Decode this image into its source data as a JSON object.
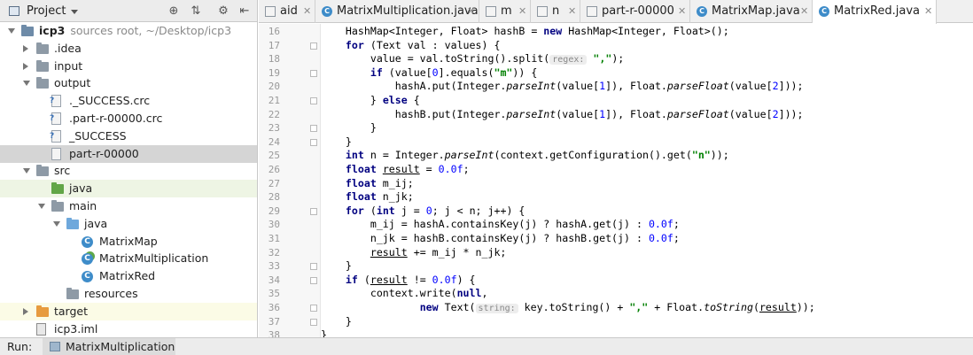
{
  "project_panel": {
    "title": "Project",
    "tree": [
      {
        "label": "icp3",
        "hint": "sources root,  ~/Desktop/icp3",
        "bold": true,
        "depth": 0,
        "arrow": "down",
        "icon": "module-folder"
      },
      {
        "label": ".idea",
        "depth": 1,
        "arrow": "right",
        "icon": "folder"
      },
      {
        "label": "input",
        "depth": 1,
        "arrow": "right",
        "icon": "folder"
      },
      {
        "label": "output",
        "depth": 1,
        "arrow": "down",
        "icon": "folder"
      },
      {
        "label": "._SUCCESS.crc",
        "depth": 2,
        "icon": "unknown-file"
      },
      {
        "label": ".part-r-00000.crc",
        "depth": 2,
        "icon": "unknown-file"
      },
      {
        "label": "_SUCCESS",
        "depth": 2,
        "icon": "unknown-file"
      },
      {
        "label": "part-r-00000",
        "depth": 2,
        "icon": "text-file",
        "selected": true
      },
      {
        "label": "src",
        "depth": 1,
        "arrow": "down",
        "icon": "folder"
      },
      {
        "label": "java",
        "depth": 2,
        "icon": "green-folder",
        "highlight": "green"
      },
      {
        "label": "main",
        "depth": 2,
        "arrow": "down",
        "icon": "folder"
      },
      {
        "label": "java",
        "depth": 3,
        "arrow": "down",
        "icon": "blue-folder"
      },
      {
        "label": "MatrixMap",
        "depth": 4,
        "icon": "class"
      },
      {
        "label": "MatrixMultiplication",
        "depth": 4,
        "icon": "class-run"
      },
      {
        "label": "MatrixRed",
        "depth": 4,
        "icon": "class"
      },
      {
        "label": "resources",
        "depth": 3,
        "icon": "resources-folder"
      },
      {
        "label": "target",
        "depth": 1,
        "arrow": "right",
        "icon": "orange-folder",
        "highlight": "yellow"
      },
      {
        "label": "icp3.iml",
        "depth": 1,
        "icon": "iml-file"
      }
    ]
  },
  "editor": {
    "tabs": [
      {
        "label": "aid",
        "icon": "file",
        "width": 64
      },
      {
        "label": "MatrixMultiplication.java",
        "icon": "class",
        "width": 185
      },
      {
        "label": "m",
        "icon": "file",
        "width": 58
      },
      {
        "label": "n",
        "icon": "file",
        "width": 56
      },
      {
        "label": "part-r-00000",
        "icon": "file",
        "width": 124
      },
      {
        "label": "MatrixMap.java",
        "icon": "class",
        "width": 138
      },
      {
        "label": "MatrixRed.java",
        "icon": "class",
        "width": 140,
        "active": true
      }
    ],
    "first_line": 16,
    "lines": [
      [
        [
          "    HashMap<Integer, Float> hashB = ",
          ""
        ],
        [
          "new",
          "k"
        ],
        [
          " HashMap<Integer, Float>();",
          ""
        ]
      ],
      [
        [
          "    ",
          ""
        ],
        [
          "for",
          "k"
        ],
        [
          " (Text val : values) {",
          ""
        ]
      ],
      [
        [
          "        value = val.toString().split(",
          ""
        ],
        [
          "regex:",
          "hint"
        ],
        [
          " ",
          ""
        ],
        [
          "\",\"",
          "s"
        ],
        [
          ");",
          ""
        ]
      ],
      [
        [
          "        ",
          ""
        ],
        [
          "if",
          "k"
        ],
        [
          " (value[",
          ""
        ],
        [
          "0",
          "n"
        ],
        [
          "].equals(",
          ""
        ],
        [
          "\"m\"",
          "s"
        ],
        [
          ")) {",
          ""
        ]
      ],
      [
        [
          "            hashA.put(Integer.",
          ""
        ],
        [
          "parseInt",
          "i"
        ],
        [
          "(value[",
          ""
        ],
        [
          "1",
          "n"
        ],
        [
          "]), Float.",
          ""
        ],
        [
          "parseFloat",
          "i"
        ],
        [
          "(value[",
          ""
        ],
        [
          "2",
          "n"
        ],
        [
          "]));",
          ""
        ]
      ],
      [
        [
          "        } ",
          ""
        ],
        [
          "else",
          "k"
        ],
        [
          " {",
          ""
        ]
      ],
      [
        [
          "            hashB.put(Integer.",
          ""
        ],
        [
          "parseInt",
          "i"
        ],
        [
          "(value[",
          ""
        ],
        [
          "1",
          "n"
        ],
        [
          "]), Float.",
          ""
        ],
        [
          "parseFloat",
          "i"
        ],
        [
          "(value[",
          ""
        ],
        [
          "2",
          "n"
        ],
        [
          "]));",
          ""
        ]
      ],
      [
        [
          "        }",
          ""
        ]
      ],
      [
        [
          "    }",
          ""
        ]
      ],
      [
        [
          "    ",
          ""
        ],
        [
          "int",
          "k"
        ],
        [
          " n = Integer.",
          ""
        ],
        [
          "parseInt",
          "i"
        ],
        [
          "(context.getConfiguration().get(",
          ""
        ],
        [
          "\"n\"",
          "s"
        ],
        [
          "));",
          ""
        ]
      ],
      [
        [
          "    ",
          ""
        ],
        [
          "float",
          "k"
        ],
        [
          " ",
          ""
        ],
        [
          "result",
          "u"
        ],
        [
          " = ",
          ""
        ],
        [
          "0.0f",
          "n"
        ],
        [
          ";",
          ""
        ]
      ],
      [
        [
          "    ",
          ""
        ],
        [
          "float",
          "k"
        ],
        [
          " m_ij;",
          ""
        ]
      ],
      [
        [
          "    ",
          ""
        ],
        [
          "float",
          "k"
        ],
        [
          " n_jk;",
          ""
        ]
      ],
      [
        [
          "    ",
          ""
        ],
        [
          "for",
          "k"
        ],
        [
          " (",
          ""
        ],
        [
          "int",
          "k"
        ],
        [
          " j = ",
          ""
        ],
        [
          "0",
          "n"
        ],
        [
          "; j < n; j++) {",
          ""
        ]
      ],
      [
        [
          "        m_ij = hashA.containsKey(j) ? hashA.get(j) : ",
          ""
        ],
        [
          "0.0f",
          "n"
        ],
        [
          ";",
          ""
        ]
      ],
      [
        [
          "        n_jk = hashB.containsKey(j) ? hashB.get(j) : ",
          ""
        ],
        [
          "0.0f",
          "n"
        ],
        [
          ";",
          ""
        ]
      ],
      [
        [
          "        ",
          ""
        ],
        [
          "result",
          "u"
        ],
        [
          " += m_ij * n_jk;",
          ""
        ]
      ],
      [
        [
          "    }",
          ""
        ]
      ],
      [
        [
          "    ",
          ""
        ],
        [
          "if",
          "k"
        ],
        [
          " (",
          ""
        ],
        [
          "result",
          "u"
        ],
        [
          " != ",
          ""
        ],
        [
          "0.0f",
          "n"
        ],
        [
          ") {",
          ""
        ]
      ],
      [
        [
          "        context.write(",
          ""
        ],
        [
          "null",
          "k"
        ],
        [
          ",",
          ""
        ]
      ],
      [
        [
          "                ",
          ""
        ],
        [
          "new",
          "k"
        ],
        [
          " Text(",
          ""
        ],
        [
          "string:",
          "hint"
        ],
        [
          " key.toString() + ",
          ""
        ],
        [
          "\",\"",
          "s"
        ],
        [
          " + Float.",
          ""
        ],
        [
          "toString",
          "i"
        ],
        [
          "(",
          ""
        ],
        [
          "result",
          "u"
        ],
        [
          "));",
          ""
        ]
      ],
      [
        [
          "    }",
          ""
        ]
      ],
      [
        [
          "}",
          ""
        ]
      ],
      [
        [
          "}",
          ""
        ]
      ]
    ],
    "fold_markers": [
      17,
      19,
      21,
      23,
      24,
      29,
      33,
      34,
      36,
      37
    ]
  },
  "run_bar": {
    "label": "Run:",
    "tab": "MatrixMultiplication"
  }
}
